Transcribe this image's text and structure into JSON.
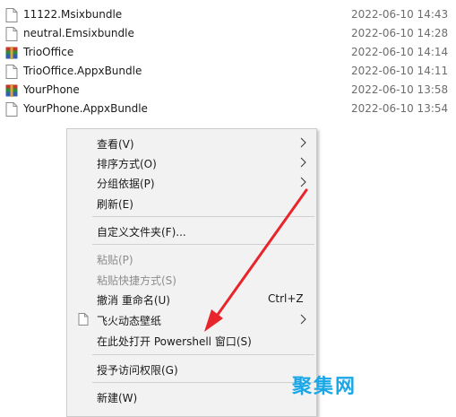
{
  "files": [
    {
      "name": "11122.Msixbundle",
      "date": "2022-06-10 14:43",
      "icon": "blank-file-icon"
    },
    {
      "name": "neutral.Emsixbundle",
      "date": "2022-06-10 14:28",
      "icon": "blank-file-icon"
    },
    {
      "name": "TrioOffice",
      "date": "2022-06-10 14:14",
      "icon": "archive-icon"
    },
    {
      "name": "TrioOffice.AppxBundle",
      "date": "2022-06-10 14:11",
      "icon": "blank-file-icon"
    },
    {
      "name": "YourPhone",
      "date": "2022-06-10 13:58",
      "icon": "archive-icon"
    },
    {
      "name": "YourPhone.AppxBundle",
      "date": "2022-06-10 13:54",
      "icon": "blank-file-icon"
    }
  ],
  "context_menu": {
    "view": "查看(V)",
    "sort_by": "排序方式(O)",
    "group_by": "分组依据(P)",
    "refresh": "刷新(E)",
    "customize_folder": "自定义文件夹(F)...",
    "paste": "粘贴(P)",
    "paste_shortcut": "粘贴快捷方式(S)",
    "undo_rename": "撤消 重命名(U)",
    "undo_shortcut": "Ctrl+Z",
    "wallpaper": "飞火动态壁纸",
    "open_powershell": "在此处打开 Powershell 窗口(S)",
    "give_access": "授予访问权限(G)",
    "new": "新建(W)"
  },
  "watermark": "聚集网",
  "colors": {
    "arrow": "#e8252b",
    "watermark": "#1aa7e8",
    "menu_bg": "#f2f2f2"
  }
}
